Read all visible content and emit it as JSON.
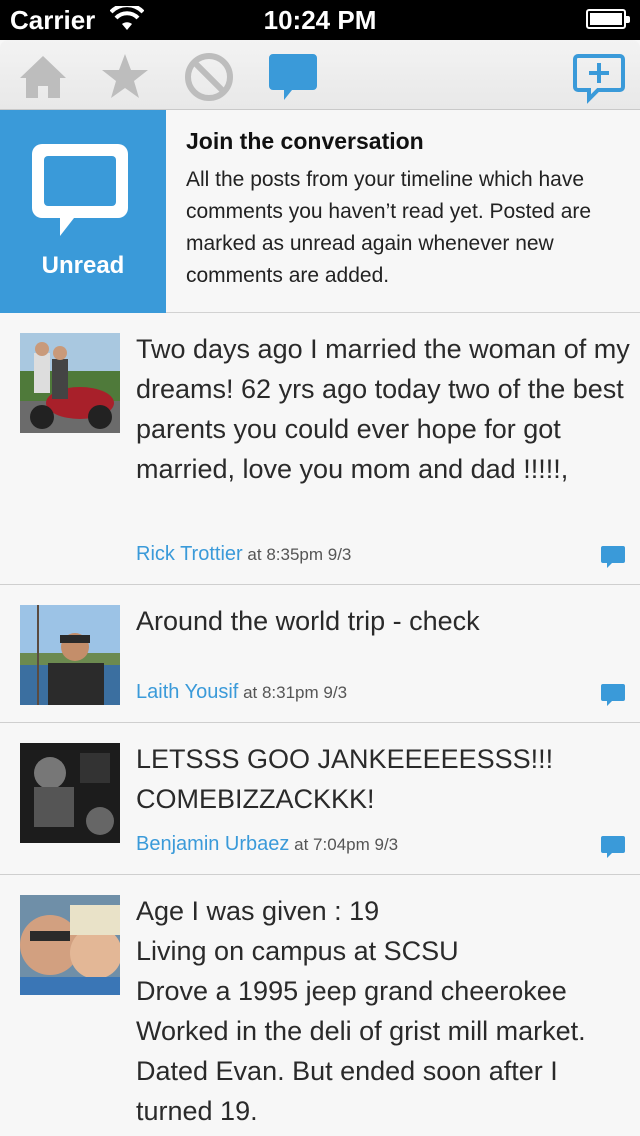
{
  "status_bar": {
    "carrier": "Carrier",
    "time": "10:24 PM"
  },
  "toolbar": {
    "icons": [
      "home-icon",
      "star-icon",
      "blocked-icon",
      "chat-bubble-icon",
      "new-message-icon"
    ],
    "active_color": "#3a9ad9",
    "inactive_color": "#bdbdbd"
  },
  "banner": {
    "tile_label": "Unread",
    "title": "Join the conversation",
    "description": "All the posts from your timeline which have comments you haven’t read yet. Posted are marked as unread again whenever new comments are added."
  },
  "posts": [
    {
      "text": "Two days ago I married the woman of my dreams! 62 yrs ago today two of the best parents you could ever hope for got married, love you mom and dad !!!!!,",
      "author": "Rick Trottier",
      "meta": "at 8:35pm 9/3"
    },
    {
      "text": "Around the world trip - check",
      "author": "Laith Yousif",
      "meta": "at 8:31pm 9/3"
    },
    {
      "text": "LETSSS GOO JANKEEEEESSS!!! COMEBIZZACKKK!",
      "author": "Benjamin Urbaez",
      "meta": "at 7:04pm 9/3"
    },
    {
      "text": "Age I was given : 19\nLiving on campus at SCSU\nDrove a 1995 jeep grand cheerokee\nWorked in the deli of grist mill market.\nDated Evan. But ended soon after I turned 19.",
      "author": "",
      "meta": ""
    }
  ]
}
